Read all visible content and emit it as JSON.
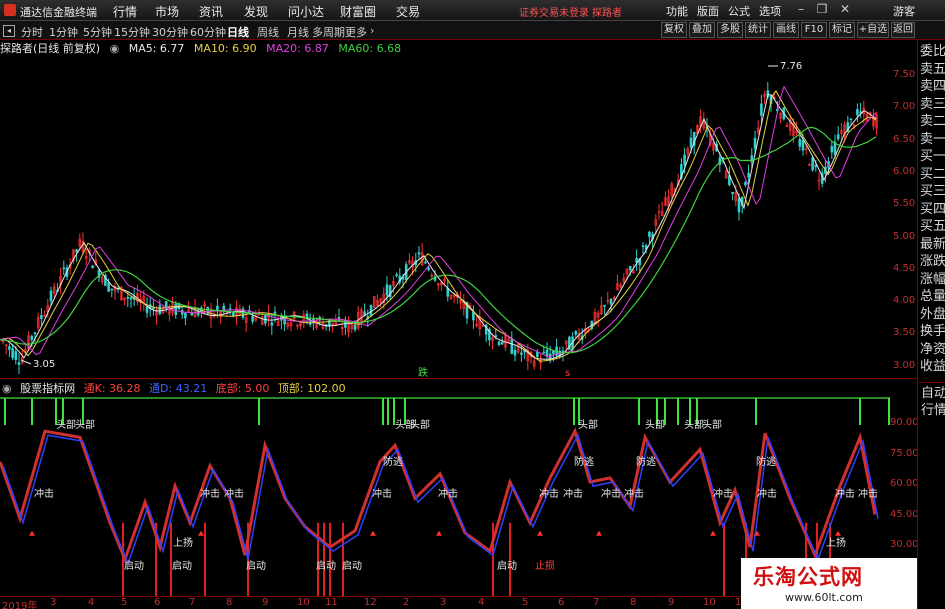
{
  "app": {
    "title": "通达信金融终端",
    "login_status": "证券交易未登录",
    "search_link": "探路者",
    "menu": [
      "行情",
      "市场",
      "资讯",
      "发现",
      "问小达",
      "财富圈",
      "交易"
    ],
    "top_menu": [
      "功能",
      "版面",
      "公式",
      "选项"
    ],
    "guest": "游客"
  },
  "toolbar": {
    "periods": [
      "分时",
      "1分钟",
      "5分钟",
      "15分钟",
      "30分钟",
      "60分钟",
      "日线",
      "周线",
      "月线",
      "多周期",
      "更多"
    ],
    "active": "日线",
    "right": [
      "复权",
      "叠加",
      "多股",
      "统计",
      "画线",
      "F10",
      "标记",
      "+自选",
      "返回"
    ]
  },
  "stock": {
    "name": "探路者(日线 前复权)",
    "ma": [
      {
        "label": "MA5: 6.77",
        "color": "#e8e8e8"
      },
      {
        "label": "MA10: 6.90",
        "color": "#e8d040"
      },
      {
        "label": "MA20: 6.87",
        "color": "#e040e0"
      },
      {
        "label": "MA60: 6.68",
        "color": "#40d040"
      }
    ]
  },
  "right_panel": [
    "委比",
    "卖五",
    "卖四",
    "卖三",
    "卖二",
    "卖一",
    "买一",
    "买二",
    "买三",
    "买四",
    "买五",
    "最新",
    "涨跌",
    "涨幅",
    "总量",
    "外盘",
    "换手",
    "净资",
    "收益"
  ],
  "right_panel_bottom": [
    "自动",
    "行情"
  ],
  "price_axis": [
    "7.50",
    "7.00",
    "6.50",
    "6.00",
    "5.50",
    "5.00",
    "4.50",
    "4.00",
    "3.50",
    "3.00"
  ],
  "price_marks": {
    "high": "7.76",
    "low": "3.05"
  },
  "indicator": {
    "name": "股票指标网",
    "lines": [
      {
        "label": "通K: 36.28",
        "color": "#ff4040"
      },
      {
        "label": "通D: 43.21",
        "color": "#4060ff"
      },
      {
        "label": "底部: 5.00",
        "color": "#ff4040"
      },
      {
        "label": "顶部: 102.00",
        "color": "#e8d040"
      }
    ],
    "axis": [
      "90.00",
      "75.00",
      "60.00",
      "45.00",
      "30.00"
    ]
  },
  "signals": {
    "top": "头部",
    "escape": "防逃",
    "impact": "冲击",
    "start": "启动",
    "rise": "上扬",
    "stop": "止损",
    "buy": "跌"
  },
  "xaxis": [
    "2019年",
    "3",
    "4",
    "5",
    "6",
    "7",
    "8",
    "9",
    "10",
    "11",
    "12",
    "2",
    "3",
    "4",
    "5",
    "6",
    "7",
    "8",
    "9",
    "10",
    "11"
  ],
  "watermark": {
    "title": "乐淘公式网",
    "url": "www.60lt.com"
  },
  "colors": {
    "up": "#ff3030",
    "down": "#30d0d0",
    "ma5": "#e8e8e8",
    "ma10": "#e8d040",
    "ma20": "#e040e0",
    "ma60": "#40d040",
    "k": "#d03030",
    "d": "#3040ff",
    "signal": "#40e040"
  }
}
